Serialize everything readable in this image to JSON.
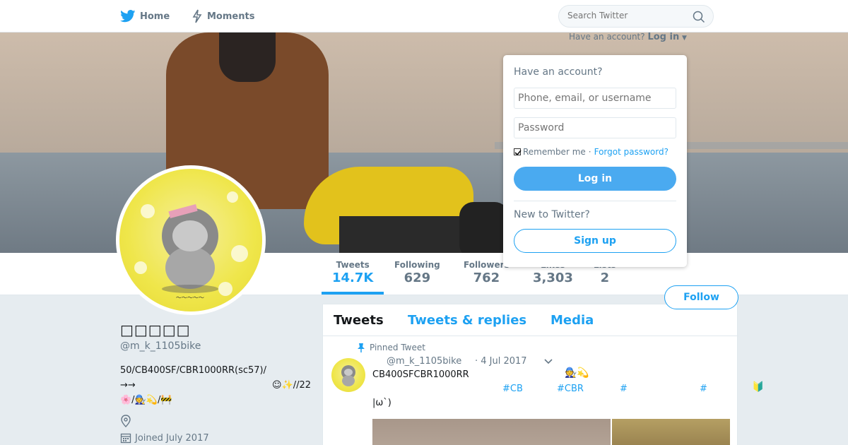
{
  "nav": {
    "home": "Home",
    "moments": "Moments",
    "search_placeholder": "Search Twitter"
  },
  "login_prompt": {
    "have_account": "Have an account?",
    "login_link": "Log in"
  },
  "login_dropdown": {
    "title": "Have an account?",
    "username_placeholder": "Phone, email, or username",
    "password_placeholder": "Password",
    "remember": "Remember me",
    "separator": "·",
    "forgot": "Forgot password?",
    "login_button": "Log in",
    "new_title": "New to Twitter?",
    "signup_button": "Sign up"
  },
  "stats": [
    {
      "label": "Tweets",
      "value": "14.7K"
    },
    {
      "label": "Following",
      "value": "629"
    },
    {
      "label": "Followers",
      "value": "762"
    },
    {
      "label": "Likes",
      "value": "3,303"
    },
    {
      "label": "Lists",
      "value": "2"
    }
  ],
  "follow_button": "Follow",
  "profile": {
    "name": "□□□□□",
    "handle": "@m_k_1105bike",
    "bio_line1": "50/CB400SF/CBR1000RR(sc57)/",
    "bio_line2_left": "→→",
    "bio_line2_right": "☺✨//22",
    "bio_line3": "🌸/🧑‍🔧💫/🚧",
    "joined": "Joined July 2017"
  },
  "timeline": {
    "tabs": [
      "Tweets",
      "Tweets & replies",
      "Media"
    ],
    "pinned_label": "Pinned Tweet",
    "tweet": {
      "handle": "@m_k_1105bike",
      "date": "· 4 Jul 2017",
      "text": "CB400SFCBR1000RR",
      "emoji": "🧑‍🔧💫",
      "hashtags": [
        "#CB",
        "#CBR",
        "#",
        "#"
      ],
      "badge": "🔰",
      "text2": "|ω`)"
    }
  }
}
